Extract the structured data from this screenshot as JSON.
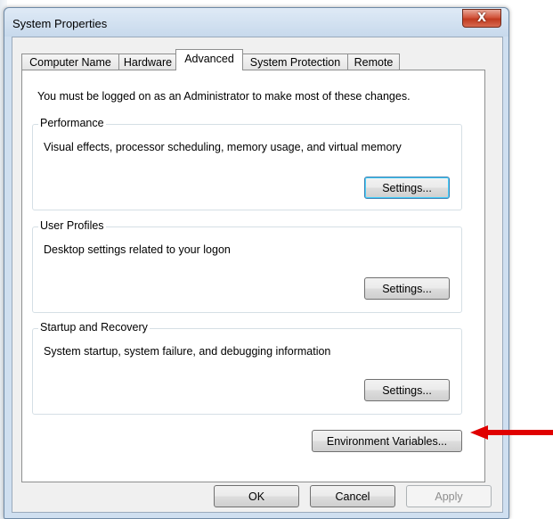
{
  "window": {
    "title": "System Properties",
    "close_label": "X"
  },
  "tabs": [
    {
      "label": "Computer Name",
      "active": false
    },
    {
      "label": "Hardware",
      "active": false
    },
    {
      "label": "Advanced",
      "active": true
    },
    {
      "label": "System Protection",
      "active": false
    },
    {
      "label": "Remote",
      "active": false
    }
  ],
  "notice": "You must be logged on as an Administrator to make most of these changes.",
  "groups": {
    "performance": {
      "title": "Performance",
      "description": "Visual effects, processor scheduling, memory usage, and virtual memory",
      "button": "Settings..."
    },
    "user_profiles": {
      "title": "User Profiles",
      "description": "Desktop settings related to your logon",
      "button": "Settings..."
    },
    "startup_recovery": {
      "title": "Startup and Recovery",
      "description": "System startup, system failure, and debugging information",
      "button": "Settings..."
    }
  },
  "env_button": "Environment Variables...",
  "footer": {
    "ok": "OK",
    "cancel": "Cancel",
    "apply": "Apply"
  },
  "colors": {
    "annotation_arrow": "#e00000",
    "window_frame": "#cfdff0",
    "close_button": "#c8452b"
  }
}
